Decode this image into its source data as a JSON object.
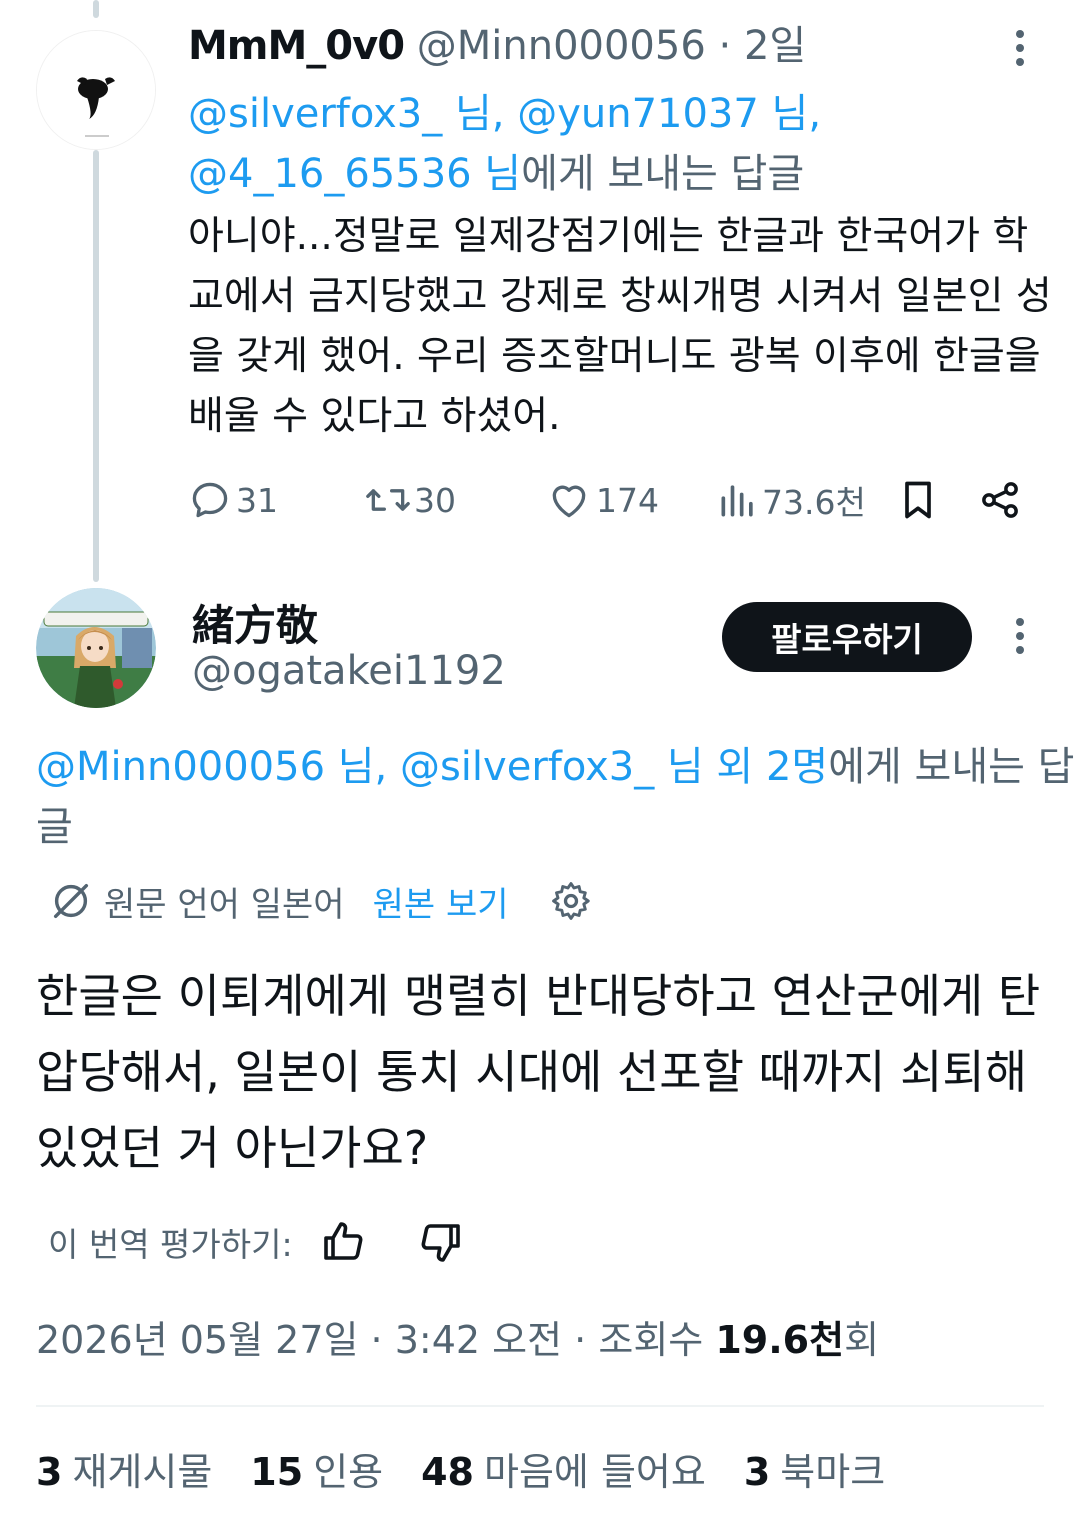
{
  "tweet1": {
    "display_name": "MmM_0v0",
    "handle": "@Minn000056",
    "separator": "·",
    "time": "2일",
    "reply_to": {
      "mention1": "@silverfox3_ 님,",
      "mention2": "@yun71037 님,",
      "mention3": "@4_16_65536 님",
      "suffix": "에게 보내는 답글"
    },
    "body": "아니야...정말로 일제강점기에는 한글과 한국어가 학교에서 금지당했고 강제로 창씨개명 시켜서 일본인 성을 갖게 했어. 우리 증조할머니도 광복 이후에 한글을 배울 수 있다고 하셨어.",
    "actions": {
      "replies": "31",
      "retweets": "30",
      "likes": "174",
      "views": "73.6천"
    }
  },
  "tweet2": {
    "display_name": "緒方敬",
    "handle": "@ogatakei1192",
    "follow_label": "팔로우하기",
    "reply_to": {
      "mentions": "@Minn000056 님, @silverfox3_ 님 외 2명",
      "suffix": "에게 보내는 답글"
    },
    "translation": {
      "source_language": "원문 언어 일본어",
      "show_original": "원본 보기"
    },
    "body": "한글은 이퇴계에게 맹렬히 반대당하고 연산군에게 탄압당해서, 일본이 통치 시대에 선포할 때까지 쇠퇴해 있었던 거 아닌가요?",
    "rate_translation": "이 번역 평가하기:",
    "meta": {
      "date": "2026년 05월 27일",
      "separator1": "·",
      "time": "3:42 오전",
      "separator2": "·",
      "views_prefix": "조회수",
      "views_value": "19.6천",
      "views_suffix": "회"
    },
    "stats": {
      "reposts_count": "3",
      "reposts_label": "재게시물",
      "quotes_count": "15",
      "quotes_label": "인용",
      "likes_count": "48",
      "likes_label": "마음에 들어요",
      "bookmarks_count": "3",
      "bookmarks_label": "북마크"
    }
  },
  "colors": {
    "text_primary": "#0f1419",
    "text_secondary": "#536471",
    "link": "#1d9bf0",
    "thread_line": "#cfd9de",
    "button_bg": "#0f1419"
  },
  "icons": [
    "reply-icon",
    "retweet-icon",
    "heart-icon",
    "views-icon",
    "bookmark-icon",
    "share-icon",
    "more-icon",
    "translate-icon",
    "gear-icon",
    "thumbs-up-icon",
    "thumbs-down-icon"
  ]
}
